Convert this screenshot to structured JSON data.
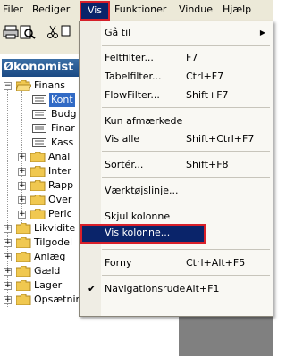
{
  "menubar": {
    "items": [
      "Filer",
      "Rediger",
      "Vis",
      "Funktioner",
      "Vindue",
      "Hjælp"
    ]
  },
  "panel": {
    "title": "Økonomist"
  },
  "tree": {
    "finans": "Finans",
    "children": [
      "Kont",
      "Budg",
      "Finar",
      "Kass",
      "Anal",
      "Inter",
      "Rapp",
      "Over",
      "Peric"
    ],
    "roots": [
      "Likvidite",
      "Tilgodel",
      "Anlæg",
      "Gæld",
      "Lager",
      "Opsætning"
    ]
  },
  "menu": {
    "goto": "Gå til",
    "feltfilter": "Feltfilter...",
    "feltfilter_key": "F7",
    "tabelfilter": "Tabelfilter...",
    "tabelfilter_key": "Ctrl+F7",
    "flowfilter": "FlowFilter...",
    "flowfilter_key": "Shift+F7",
    "kun_afmaerkede": "Kun afmærkede",
    "vis_alle": "Vis alle",
    "vis_alle_key": "Shift+Ctrl+F7",
    "sorter": "Sortér...",
    "sorter_key": "Shift+F8",
    "vaerktojslinje": "Værktøjslinje...",
    "skjul_kolonne": "Skjul kolonne",
    "vis_kolonne": "Vis kolonne...",
    "forny": "Forny",
    "forny_key": "Ctrl+Alt+F5",
    "navigationsrude": "Navigationsrude",
    "navigationsrude_key": "Alt+F1"
  },
  "colors": {
    "highlight": "#0a246a",
    "highlight_border": "#d9202a",
    "menubar": "#ece9d8"
  }
}
